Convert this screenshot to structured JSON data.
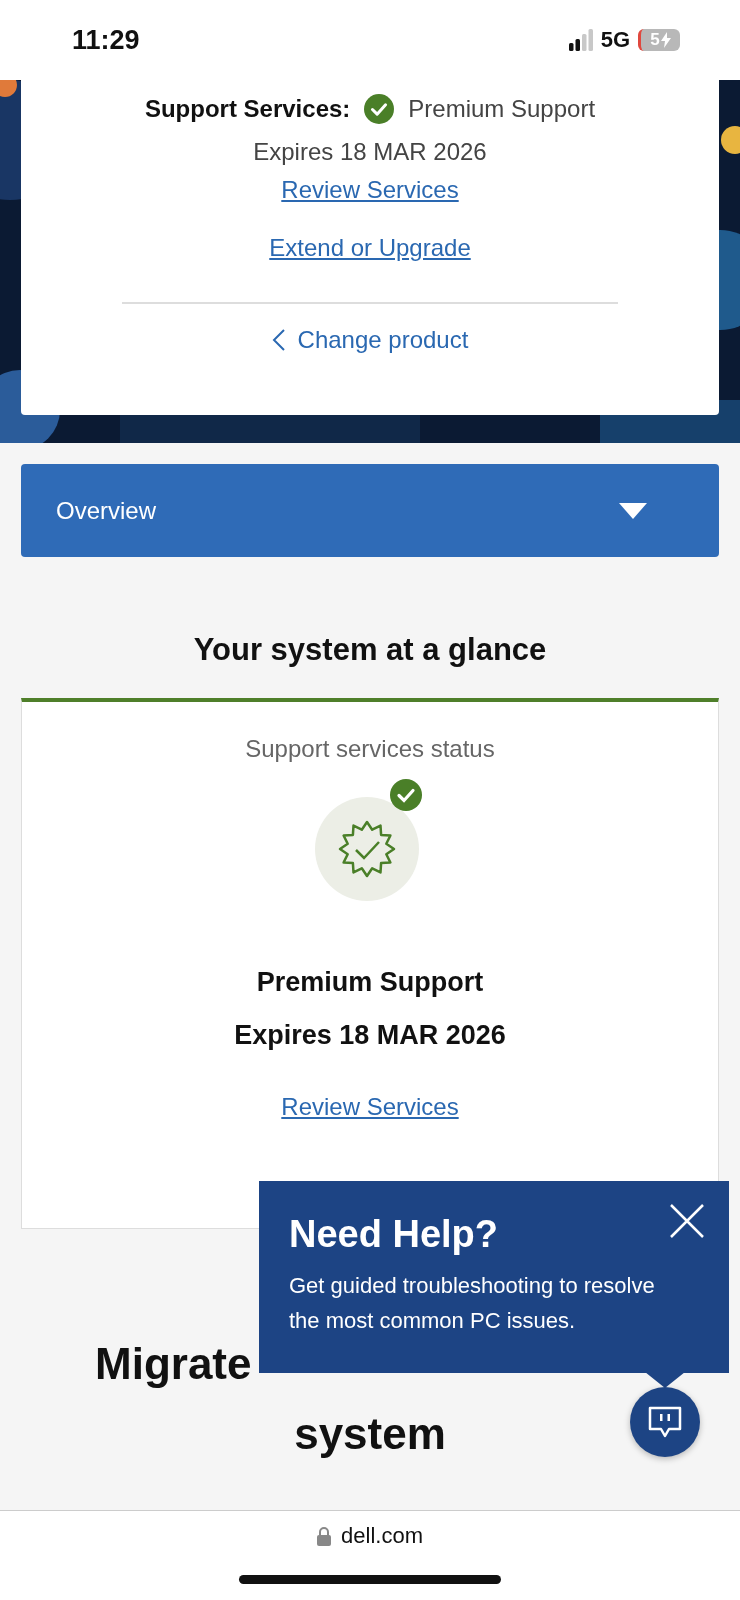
{
  "status_bar": {
    "time": "11:29",
    "network": "5G",
    "battery": "5",
    "charging": true
  },
  "product_card": {
    "label": "Support Services:",
    "service": "Premium Support",
    "expires": "Expires 18 MAR 2026",
    "links": [
      "Review Services",
      "Extend or Upgrade"
    ],
    "change_product": "Change product"
  },
  "accordion": {
    "label": "Overview",
    "expanded": false
  },
  "section_title": "Your system at a glance",
  "status_card": {
    "title": "Support services status",
    "service": "Premium Support",
    "expires": "Expires 18 MAR 2026",
    "links": [
      "Review Services"
    ]
  },
  "migrate_heading": [
    "Migrate",
    "system"
  ],
  "help_popover": {
    "title": "Need Help?",
    "body": "Get guided troubleshooting to resolve the most common PC issues."
  },
  "browser_bar": {
    "url": "dell.com"
  }
}
